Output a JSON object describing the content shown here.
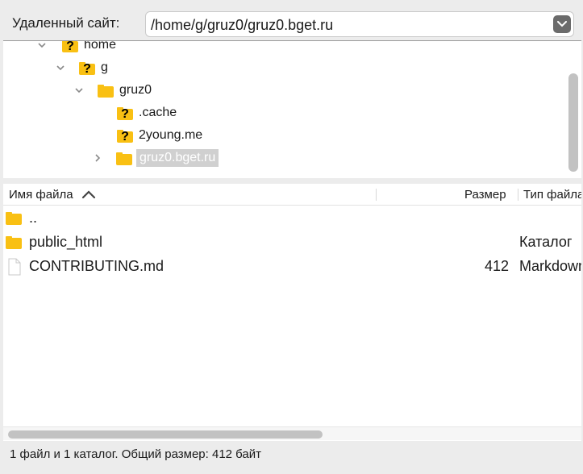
{
  "remote": {
    "label": "Удаленный сайт:",
    "path": "/home/g/gruz0/gruz0.bget.ru"
  },
  "tree": {
    "items": [
      {
        "label": "home",
        "icon": "unknown-folder-icon",
        "expanded": true
      },
      {
        "label": "g",
        "icon": "unknown-folder-icon",
        "expanded": true
      },
      {
        "label": "gruz0",
        "icon": "folder-icon",
        "expanded": true
      },
      {
        "label": ".cache",
        "icon": "unknown-folder-icon"
      },
      {
        "label": "2young.me",
        "icon": "unknown-folder-icon"
      },
      {
        "label": "gruz0.bget.ru",
        "icon": "folder-icon",
        "expanded": false,
        "selected": true
      }
    ]
  },
  "files": {
    "columns": {
      "name": "Имя файла",
      "size": "Размер",
      "type": "Тип файла"
    },
    "rows": [
      {
        "name": "..",
        "size": "",
        "type": "",
        "icon": "folder-icon"
      },
      {
        "name": "public_html",
        "size": "",
        "type": "Каталог",
        "icon": "folder-icon"
      },
      {
        "name": "CONTRIBUTING.md",
        "size": "412",
        "type": "Markdown",
        "icon": "file-icon"
      }
    ]
  },
  "status": {
    "text": "1 файл и 1 каталог. Общий размер: 412 байт"
  },
  "colors": {
    "folder": "#f9c013",
    "question": "#000000",
    "window_bg": "#ececec"
  }
}
